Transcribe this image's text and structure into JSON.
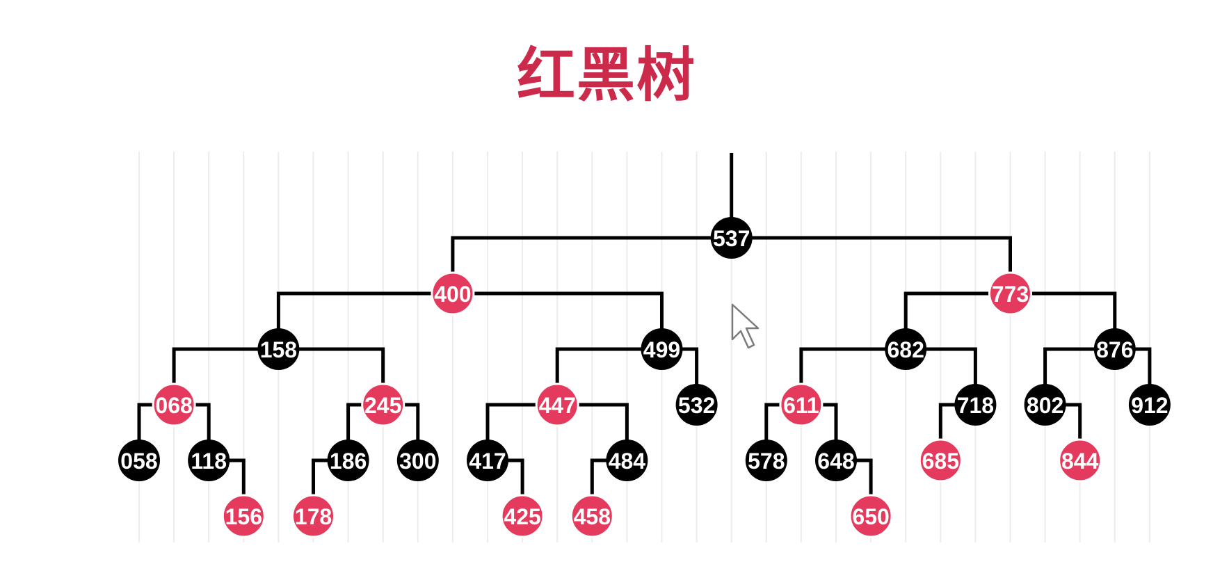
{
  "title": "红黑树",
  "colors": {
    "title": "#cc2a4b",
    "red": "#e33a5d",
    "black": "#000000",
    "label": "#ffffff",
    "grid": "#ececec"
  },
  "tree": {
    "root": "537",
    "nodes": [
      {
        "id": "537",
        "label": "537",
        "color": "black",
        "left": "400",
        "right": "773"
      },
      {
        "id": "400",
        "label": "400",
        "color": "red",
        "left": "158",
        "right": "499"
      },
      {
        "id": "773",
        "label": "773",
        "color": "red",
        "left": "682",
        "right": "876"
      },
      {
        "id": "158",
        "label": "158",
        "color": "black",
        "left": "068",
        "right": "245"
      },
      {
        "id": "499",
        "label": "499",
        "color": "black",
        "left": "447",
        "right": "532"
      },
      {
        "id": "682",
        "label": "682",
        "color": "black",
        "left": "611",
        "right": "718"
      },
      {
        "id": "876",
        "label": "876",
        "color": "black",
        "left": "802",
        "right": "912"
      },
      {
        "id": "068",
        "label": "068",
        "color": "red",
        "left": "058",
        "right": "118"
      },
      {
        "id": "245",
        "label": "245",
        "color": "red",
        "left": "186",
        "right": "300"
      },
      {
        "id": "447",
        "label": "447",
        "color": "red",
        "left": "417",
        "right": "484"
      },
      {
        "id": "532",
        "label": "532",
        "color": "black",
        "left": null,
        "right": null
      },
      {
        "id": "611",
        "label": "611",
        "color": "red",
        "left": "578",
        "right": "648"
      },
      {
        "id": "718",
        "label": "718",
        "color": "black",
        "left": "685",
        "right": null
      },
      {
        "id": "802",
        "label": "802",
        "color": "black",
        "left": null,
        "right": "844"
      },
      {
        "id": "912",
        "label": "912",
        "color": "black",
        "left": null,
        "right": null
      },
      {
        "id": "058",
        "label": "058",
        "color": "black",
        "left": null,
        "right": null
      },
      {
        "id": "118",
        "label": "118",
        "color": "black",
        "left": null,
        "right": "156"
      },
      {
        "id": "186",
        "label": "186",
        "color": "black",
        "left": "178",
        "right": null
      },
      {
        "id": "300",
        "label": "300",
        "color": "black",
        "left": null,
        "right": null
      },
      {
        "id": "417",
        "label": "417",
        "color": "black",
        "left": null,
        "right": "425"
      },
      {
        "id": "484",
        "label": "484",
        "color": "black",
        "left": "458",
        "right": null
      },
      {
        "id": "578",
        "label": "578",
        "color": "black",
        "left": null,
        "right": null
      },
      {
        "id": "648",
        "label": "648",
        "color": "black",
        "left": null,
        "right": "650"
      },
      {
        "id": "685",
        "label": "685",
        "color": "red",
        "left": null,
        "right": null
      },
      {
        "id": "844",
        "label": "844",
        "color": "red",
        "left": null,
        "right": null
      },
      {
        "id": "156",
        "label": "156",
        "color": "red",
        "left": null,
        "right": null
      },
      {
        "id": "178",
        "label": "178",
        "color": "red",
        "left": null,
        "right": null
      },
      {
        "id": "425",
        "label": "425",
        "color": "red",
        "left": null,
        "right": null
      },
      {
        "id": "458",
        "label": "458",
        "color": "red",
        "left": null,
        "right": null
      },
      {
        "id": "650",
        "label": "650",
        "color": "red",
        "left": null,
        "right": null
      }
    ]
  },
  "cursor_icon": "mouse-pointer-icon"
}
